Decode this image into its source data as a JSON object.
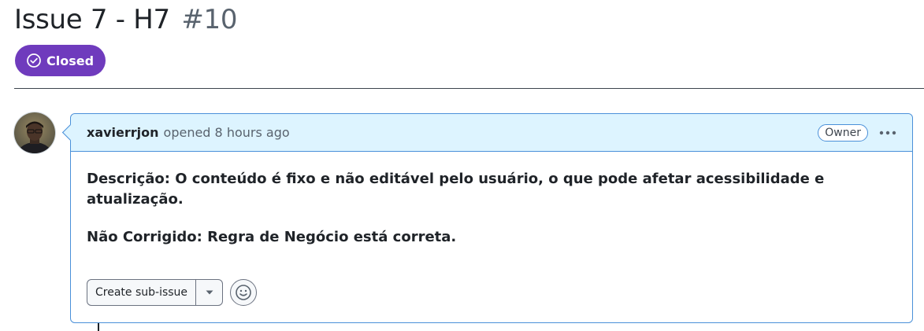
{
  "issue": {
    "title": "Issue 7 - H7",
    "number": "#10",
    "state": "Closed",
    "state_color": "#6f3bbd"
  },
  "comment": {
    "author": "xavierrjon",
    "meta": "opened 8 hours ago",
    "role_label": "Owner",
    "menu_icon": "kebab-horizontal-icon",
    "body": [
      "Descrição: O conteúdo é fixo e não editável pelo usuário, o que pode afetar acessibilidade e atualização.",
      "Não Corrigido: Regra de Negócio está correta."
    ],
    "header_bg": "#ddf4ff",
    "border_color": "#4a90d9"
  },
  "actions": {
    "create_sub_issue_label": "Create sub-issue",
    "dropdown_icon": "triangle-down-icon",
    "reaction_icon": "smiley-icon"
  },
  "avatar": {
    "icon": "avatar"
  }
}
